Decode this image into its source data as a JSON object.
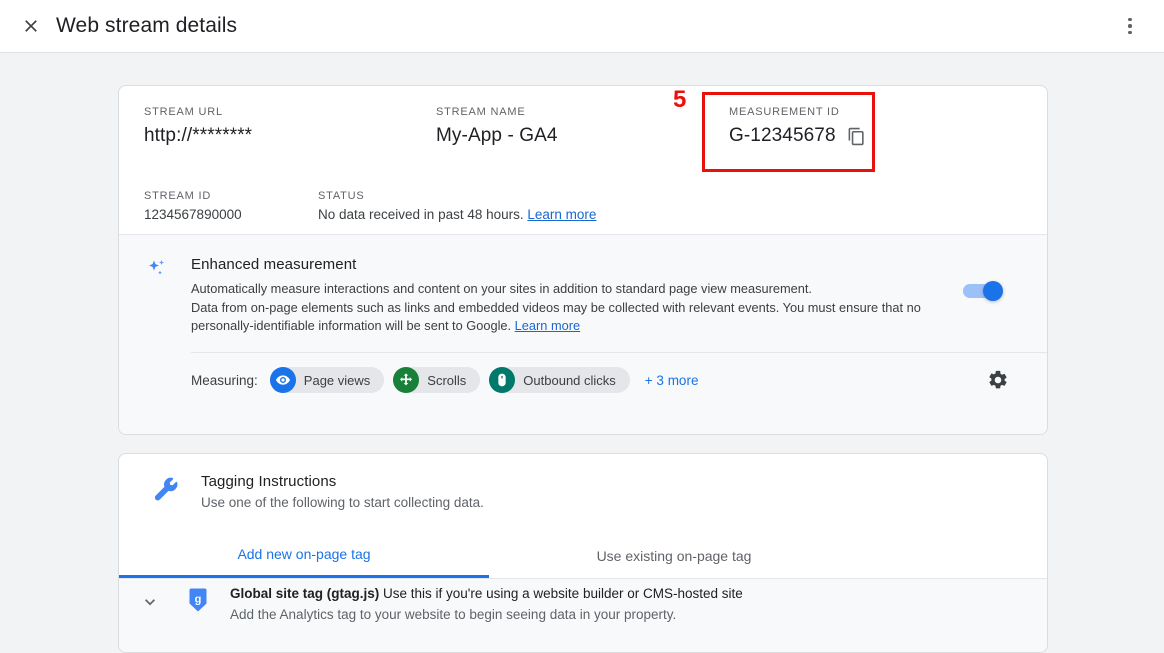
{
  "appbar": {
    "title": "Web stream details",
    "close_icon": "close-icon",
    "menu_icon": "more-vert-icon"
  },
  "stream": {
    "url_label": "STREAM URL",
    "url_value": "http://********",
    "name_label": "STREAM NAME",
    "name_value": "My-App - GA4",
    "measurement_label": "MEASUREMENT ID",
    "measurement_value": "G-12345678",
    "copy_icon": "copy-icon",
    "id_label": "STREAM ID",
    "id_value": "1234567890000",
    "status_label": "STATUS",
    "status_value": "No data received in past 48 hours.",
    "status_link": "Learn more"
  },
  "enhanced_measurement": {
    "icon": "sparkle-icon",
    "title": "Enhanced measurement",
    "body_line1": "Automatically measure interactions and content on your sites in addition to standard page view measurement.",
    "body_line2": "Data from on-page elements such as links and embedded videos may be collected with relevant events. You must ensure that no personally-identifiable information will be sent to Google.",
    "body_link": "Learn more",
    "toggle_state": "on",
    "measuring_label": "Measuring:",
    "chips": [
      {
        "label": "Page views",
        "icon": "eye-icon",
        "color": "#1a73e8"
      },
      {
        "label": "Scrolls",
        "icon": "scroll-move-icon",
        "color": "#188038"
      },
      {
        "label": "Outbound clicks",
        "icon": "mouse-icon",
        "color": "#00796b"
      }
    ],
    "more_label": "+ 3 more",
    "settings_icon": "gear-icon"
  },
  "tagging": {
    "icon": "wrench-icon",
    "title": "Tagging Instructions",
    "subtitle": "Use one of the following to start collecting data.",
    "tabs": [
      {
        "label": "Add new on-page tag",
        "active": true
      },
      {
        "label": "Use existing on-page tag",
        "active": false
      }
    ],
    "gtag": {
      "chevron_icon": "chevron-down-icon",
      "tag_icon": "google-tag-icon",
      "title": "Global site tag (gtag.js)",
      "title_rest": " Use this if you're using a website builder or CMS-hosted site",
      "subtitle": "Add the Analytics tag to your website to begin seeing data in your property."
    }
  },
  "annotation": {
    "number": "5",
    "color": "#e8110b"
  },
  "theme": {
    "accent": "#1a73e8",
    "link": "#1967d2",
    "page_bg": "#f1f3f4",
    "card_bg": "#ffffff",
    "section_bg": "#f8f9fa"
  }
}
